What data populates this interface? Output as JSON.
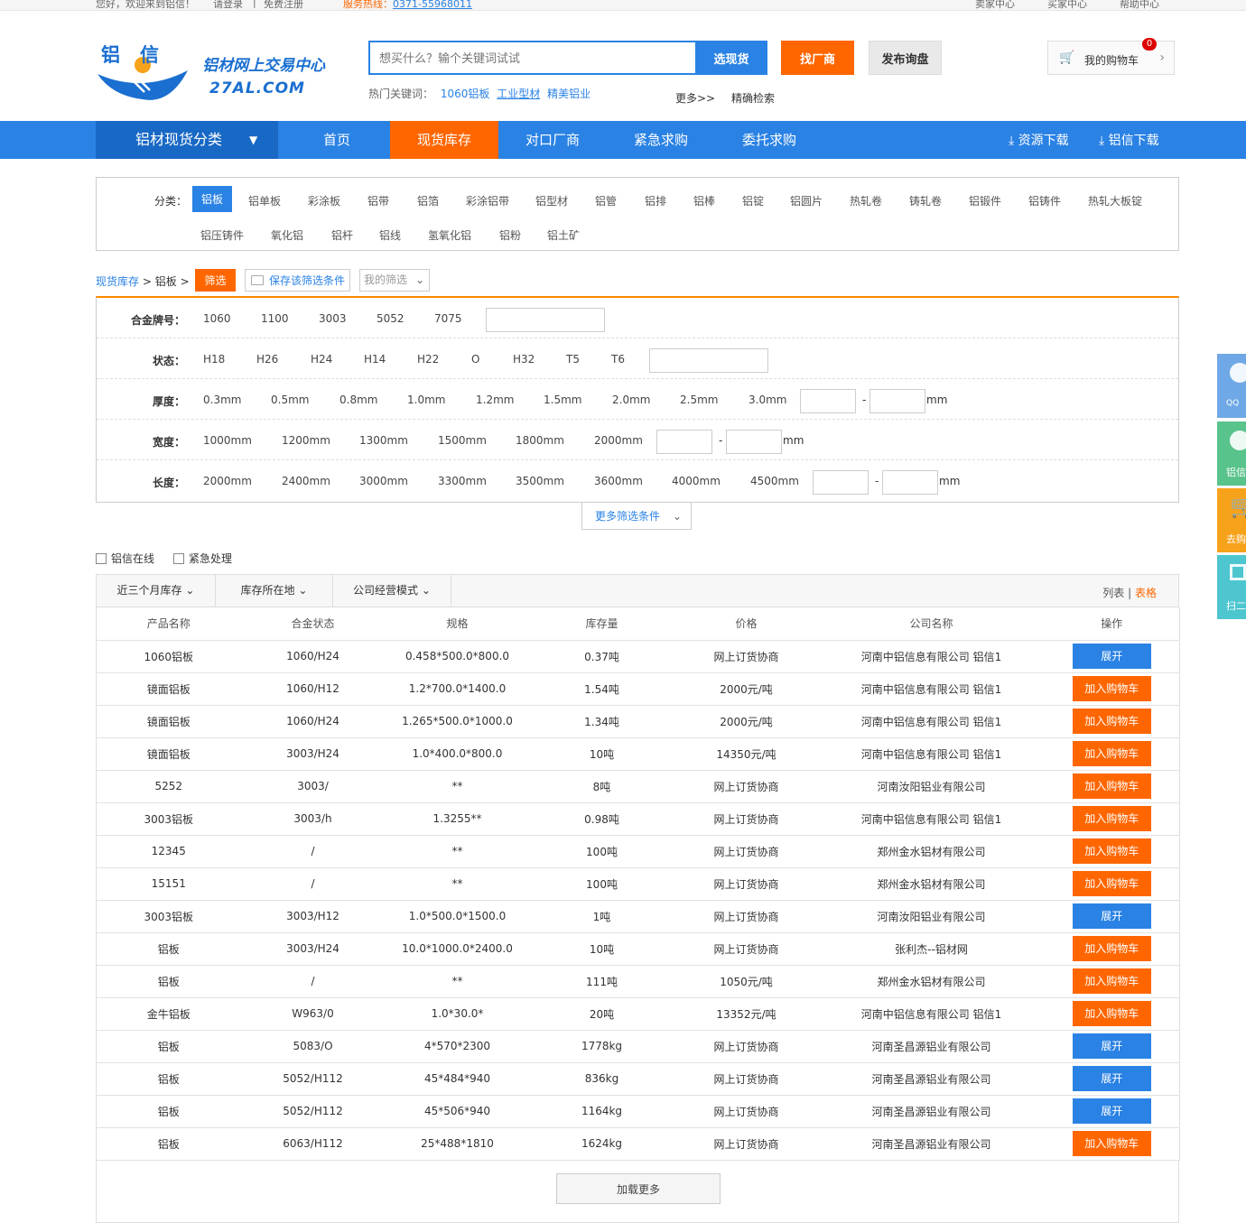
{
  "topbar": {
    "greeting": "您好，欢迎来到铝信！",
    "login": "请登录",
    "sep": "|",
    "register": "免费注册",
    "hotline_label": "服务热线：",
    "hotline": "0371-55968011",
    "seller": "卖家中心",
    "buyer": "买家中心",
    "help": "帮助中心"
  },
  "logo": {
    "cn": "铝信",
    "sub": "铝材网上交易中心",
    "en": "27AL.COM"
  },
  "search": {
    "placeholder": "想买什么？输个关键词试试",
    "btn_stock": "选现货",
    "btn_factory": "找厂商",
    "btn_inquiry": "发布询盘",
    "hot_label": "热门关键词：",
    "hot": [
      "1060铝板",
      "工业型材",
      "精美铝业"
    ],
    "more": "更多>>",
    "precise": "精确检索"
  },
  "cart": {
    "label": "我的购物车",
    "count": "0"
  },
  "nav": {
    "category": "铝材现货分类",
    "items": [
      "首页",
      "现货库存",
      "对口厂商",
      "紧急求购",
      "委托求购"
    ],
    "res_download": "资源下载",
    "lx_download": "铝信下载"
  },
  "categories": {
    "label": "分类：",
    "row1": [
      "铝板",
      "铝单板",
      "彩涂板",
      "铝带",
      "铝箔",
      "彩涂铝带",
      "铝型材",
      "铝管",
      "铝排",
      "铝棒",
      "铝锭",
      "铝圆片",
      "热轧卷",
      "铸轧卷",
      "铝锻件",
      "铝铸件",
      "热轧大板锭"
    ],
    "row2": [
      "铝压铸件",
      "氧化铝",
      "铝杆",
      "铝线",
      "氢氧化铝",
      "铝粉",
      "铝土矿"
    ]
  },
  "crumb": {
    "stock": "现货库存",
    "sep": ">",
    "plate": "铝板",
    "filter": "筛选",
    "save": "保存该筛选条件",
    "my": "我的筛选"
  },
  "filters": [
    {
      "key": "合金牌号：",
      "vals": [
        "1060",
        "1100",
        "3003",
        "5052",
        "7075"
      ]
    },
    {
      "key": "状态：",
      "vals": [
        "H18",
        "H26",
        "H24",
        "H14",
        "H22",
        "O",
        "H32",
        "T5",
        "T6"
      ]
    },
    {
      "key": "厚度：",
      "vals": [
        "0.3mm",
        "0.5mm",
        "0.8mm",
        "1.0mm",
        "1.2mm",
        "1.5mm",
        "2.0mm",
        "2.5mm",
        "3.0mm"
      ],
      "unit": "mm"
    },
    {
      "key": "宽度：",
      "vals": [
        "1000mm",
        "1200mm",
        "1300mm",
        "1500mm",
        "1800mm",
        "2000mm"
      ],
      "unit": "mm"
    },
    {
      "key": "长度：",
      "vals": [
        "2000mm",
        "2400mm",
        "3000mm",
        "3300mm",
        "3500mm",
        "3600mm",
        "4000mm",
        "4500mm"
      ],
      "unit": "mm"
    }
  ],
  "more_filter": "更多筛选条件",
  "checks": [
    "铝信在线",
    "紧急处理"
  ],
  "listbar": {
    "dd": [
      "近三个月库存",
      "库存所在地",
      "公司经营模式"
    ],
    "list": "列表",
    "sep": "|",
    "table": "表格"
  },
  "table": {
    "headers": [
      "产品名称",
      "合金状态",
      "规格",
      "库存量",
      "价格",
      "公司名称",
      "操作"
    ],
    "rows": [
      [
        "1060铝板",
        "1060/H24",
        "0.458*500.0*800.0",
        "0.37吨",
        "网上订货协商",
        "河南中铝信息有限公司 铝信1",
        "展开"
      ],
      [
        "镜面铝板",
        "1060/H12",
        "1.2*700.0*1400.0",
        "1.54吨",
        "2000元/吨",
        "河南中铝信息有限公司 铝信1",
        "加入购物车"
      ],
      [
        "镜面铝板",
        "1060/H24",
        "1.265*500.0*1000.0",
        "1.34吨",
        "2000元/吨",
        "河南中铝信息有限公司 铝信1",
        "加入购物车"
      ],
      [
        "镜面铝板",
        "3003/H24",
        "1.0*400.0*800.0",
        "10吨",
        "14350元/吨",
        "河南中铝信息有限公司 铝信1",
        "加入购物车"
      ],
      [
        "5252",
        "3003/",
        "**",
        "8吨",
        "网上订货协商",
        "河南汝阳铝业有限公司",
        "加入购物车"
      ],
      [
        "3003铝板",
        "3003/h",
        "1.3255**",
        "0.98吨",
        "网上订货协商",
        "河南中铝信息有限公司 铝信1",
        "加入购物车"
      ],
      [
        "12345",
        "/",
        "**",
        "100吨",
        "网上订货协商",
        "郑州金水铝材有限公司",
        "加入购物车"
      ],
      [
        "15151",
        "/",
        "**",
        "100吨",
        "网上订货协商",
        "郑州金水铝材有限公司",
        "加入购物车"
      ],
      [
        "3003铝板",
        "3003/H12",
        "1.0*500.0*1500.0",
        "1吨",
        "网上订货协商",
        "河南汝阳铝业有限公司",
        "展开"
      ],
      [
        "铝板",
        "3003/H24",
        "10.0*1000.0*2400.0",
        "10吨",
        "网上订货协商",
        "张利杰--铝材网",
        "加入购物车"
      ],
      [
        "铝板",
        "/",
        "**",
        "111吨",
        "1050元/吨",
        "郑州金水铝材有限公司",
        "加入购物车"
      ],
      [
        "金牛铝板",
        "W963/0",
        "1.0*30.0*",
        "20吨",
        "13352元/吨",
        "河南中铝信息有限公司 铝信1",
        "加入购物车"
      ],
      [
        "铝板",
        "5083/O",
        "4*570*2300",
        "1778kg",
        "网上订货协商",
        "河南圣昌源铝业有限公司",
        "展开"
      ],
      [
        "铝板",
        "5052/H112",
        "45*484*940",
        "836kg",
        "网上订货协商",
        "河南圣昌源铝业有限公司",
        "展开"
      ],
      [
        "铝板",
        "5052/H112",
        "45*506*940",
        "1164kg",
        "网上订货协商",
        "河南圣昌源铝业有限公司",
        "展开"
      ],
      [
        "铝板",
        "6063/H112",
        "25*488*1810",
        "1624kg",
        "网上订货协商",
        "河南圣昌源铝业有限公司",
        "加入购物车"
      ]
    ]
  },
  "load_more": "加载更多",
  "side": {
    "qq": "QQ",
    "lx": "铝信",
    "cart": "去购",
    "scan": "扫二"
  },
  "colors": {
    "blue": "#2a82e4",
    "orange": "#ff6600"
  }
}
